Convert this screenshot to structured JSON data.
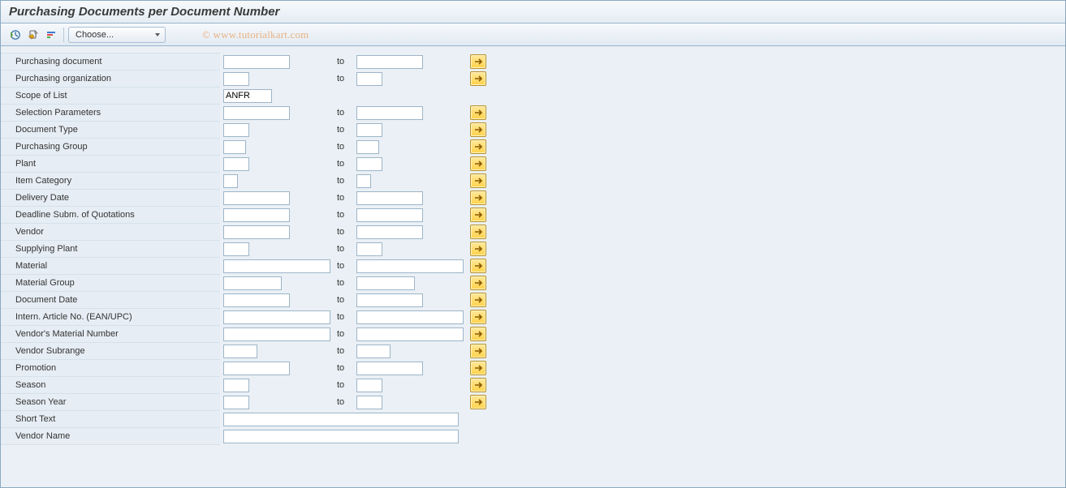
{
  "title": "Purchasing Documents per Document Number",
  "toolbar": {
    "choose_label": "Choose..."
  },
  "watermark": "© www.tutorialkart.com",
  "to_label": "to",
  "scope_of_list_value": "ANFR",
  "rows": {
    "purchasing_document": "Purchasing document",
    "purchasing_org": "Purchasing organization",
    "scope_of_list": "Scope of List",
    "selection_params": "Selection Parameters",
    "document_type": "Document Type",
    "purchasing_group": "Purchasing Group",
    "plant": "Plant",
    "item_category": "Item Category",
    "delivery_date": "Delivery Date",
    "deadline_quot": "Deadline Subm. of Quotations",
    "vendor": "Vendor",
    "supplying_plant": "Supplying Plant",
    "material": "Material",
    "material_group": "Material Group",
    "document_date": "Document Date",
    "ean_upc": "Intern. Article No. (EAN/UPC)",
    "vendor_matnr": "Vendor's Material Number",
    "vendor_subrange": "Vendor Subrange",
    "promotion": "Promotion",
    "season": "Season",
    "season_year": "Season Year",
    "short_text": "Short Text",
    "vendor_name": "Vendor Name"
  }
}
